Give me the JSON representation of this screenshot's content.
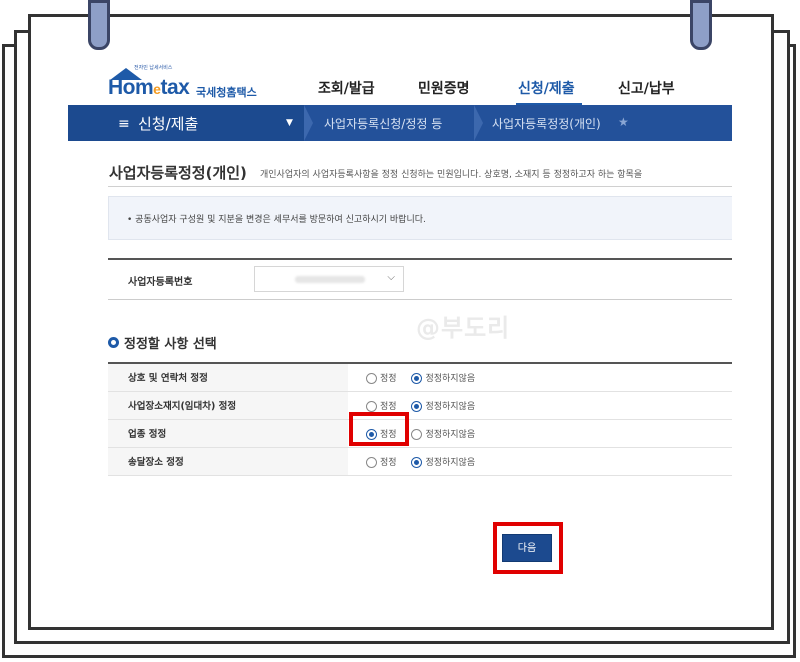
{
  "logo": {
    "tagline": "전자민 납세서비스",
    "mark_pre": "Hom",
    "mark_e": "e",
    "mark_post": "tax",
    "korean": "국세청홈택스"
  },
  "gnb": [
    "조회/발급",
    "민원증명",
    "신청/제출",
    "신고/납부"
  ],
  "locbar": {
    "menu_label": "신청/제출",
    "crumb1": "사업자등록신청/정정 등",
    "crumb2": "사업자등록정정(개인)"
  },
  "page": {
    "title": "사업자등록정정(개인)",
    "description": "개인사업자의 사업자등록사항을 정정 신청하는 민원입니다. 상호명, 소재지 등 정정하고자 하는 항목을",
    "notice": "• 공동사업자 구성원 및 지분을 변경은 세무서를 방문하여 신고하시기 바랍니다."
  },
  "reg": {
    "label": "사업자등록번호"
  },
  "section": {
    "title": "정정할 사항 선택"
  },
  "watermark": "@부도리",
  "options": [
    {
      "label": "상호 및 연락처 정정",
      "opt1": "정정",
      "opt2": "정정하지않음",
      "selected": 2
    },
    {
      "label": "사업장소재지(임대차) 정정",
      "opt1": "정정",
      "opt2": "정정하지않음",
      "selected": 2
    },
    {
      "label": "업종 정정",
      "opt1": "정정",
      "opt2": "정정하지않음",
      "selected": 1
    },
    {
      "label": "송달장소 정정",
      "opt1": "정정",
      "opt2": "정정하지않음",
      "selected": 2
    }
  ],
  "next_button": "다음",
  "colors": {
    "primary": "#1e5aa8",
    "nav_bar": "#23519a",
    "highlight": "#e00000",
    "ring": "#8e9fc7"
  }
}
